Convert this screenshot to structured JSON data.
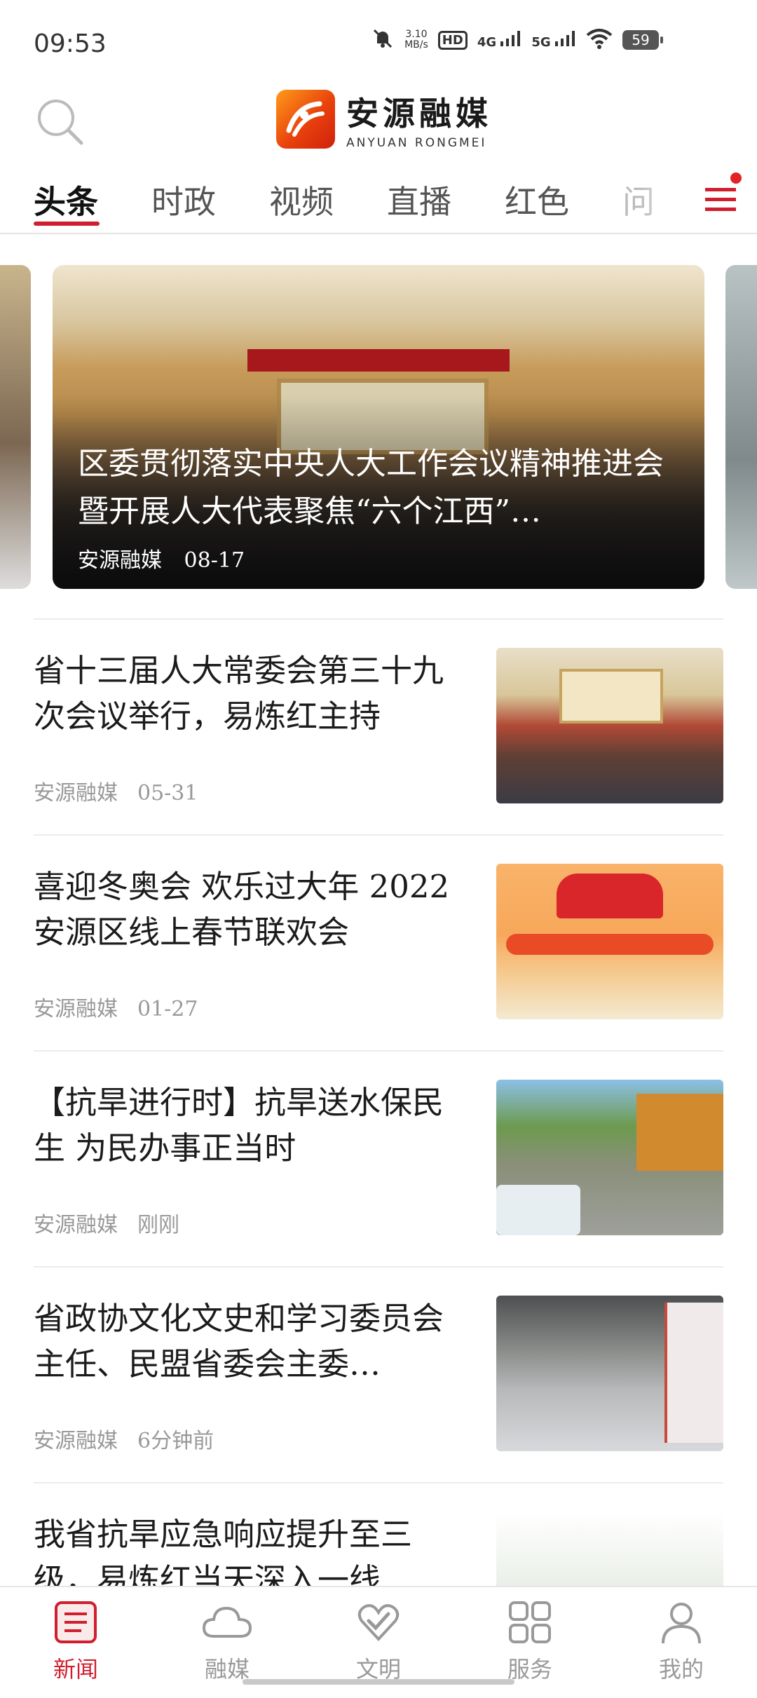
{
  "status_bar": {
    "time": "09:53",
    "net_speed": "3.10",
    "net_unit": "MB/s",
    "hd": "HD",
    "sig1": "4G",
    "sig2": "5G",
    "battery": "59",
    "icons": [
      "mute-icon",
      "hd-icon",
      "signal-4g-icon",
      "signal-5g-icon",
      "wifi-icon",
      "battery-icon"
    ]
  },
  "header": {
    "search_icon": "search-icon",
    "logo_cn": "安源融媒",
    "logo_en": "ANYUAN RONGMEI"
  },
  "tabs": [
    {
      "label": "头条",
      "active": true
    },
    {
      "label": "时政",
      "active": false
    },
    {
      "label": "视频",
      "active": false
    },
    {
      "label": "直播",
      "active": false
    },
    {
      "label": "红色",
      "active": false
    },
    {
      "label": "问",
      "active": false
    }
  ],
  "menu_icon": "menu-icon",
  "carousel": {
    "title": "区委贯彻落实中央人大工作会议精神推进会暨开展人大代表聚焦“六个江西”…",
    "source": "安源融媒",
    "date": "08-17"
  },
  "news": [
    {
      "title": "省十三届人大常委会第三十九次会议举行，易炼红主持",
      "source": "安源融媒",
      "time": "05-31"
    },
    {
      "title": "喜迎冬奥会 欢乐过大年 2022安源区线上春节联欢会",
      "source": "安源融媒",
      "time": "01-27"
    },
    {
      "title": "【抗旱进行时】抗旱送水保民生 为民办事正当时",
      "source": "安源融媒",
      "time": "刚刚"
    },
    {
      "title": "省政协文化文史和学习委员会主任、民盟省委会主委…",
      "source": "安源融媒",
      "time": "6分钟前"
    },
    {
      "title": "我省抗旱应急响应提升至三级，易炼红当天深入一线…",
      "source": "",
      "time": ""
    }
  ],
  "bottom_nav": [
    {
      "label": "新闻",
      "icon": "news-icon",
      "active": true
    },
    {
      "label": "融媒",
      "icon": "cloud-icon",
      "active": false
    },
    {
      "label": "文明",
      "icon": "heart-hand-icon",
      "active": false
    },
    {
      "label": "服务",
      "icon": "grid-icon",
      "active": false
    },
    {
      "label": "我的",
      "icon": "person-icon",
      "active": false
    }
  ],
  "colors": {
    "accent": "#cf1f2e",
    "muted": "#999999"
  }
}
